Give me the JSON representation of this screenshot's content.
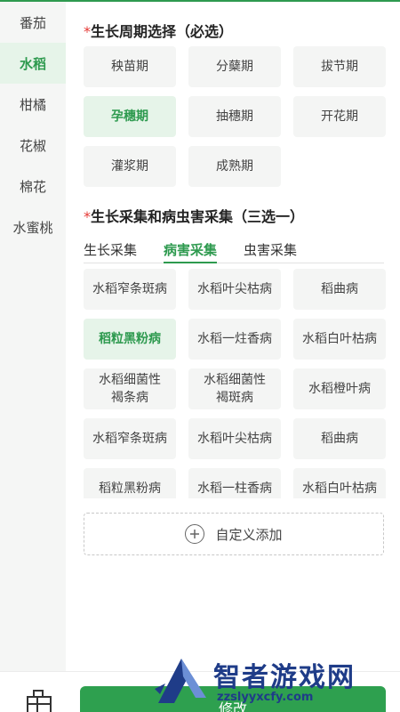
{
  "sidebar": {
    "items": [
      {
        "label": "番茄",
        "active": false
      },
      {
        "label": "水稻",
        "active": true
      },
      {
        "label": "柑橘",
        "active": false
      },
      {
        "label": "花椒",
        "active": false
      },
      {
        "label": "棉花",
        "active": false
      },
      {
        "label": "水蜜桃",
        "active": false
      }
    ]
  },
  "growth_period": {
    "required_mark": "*",
    "title": "生长周期选择（必选）",
    "options": [
      {
        "label": "秧苗期",
        "selected": false
      },
      {
        "label": "分蘖期",
        "selected": false
      },
      {
        "label": "拔节期",
        "selected": false
      },
      {
        "label": "孕穗期",
        "selected": true
      },
      {
        "label": "抽穗期",
        "selected": false
      },
      {
        "label": "开花期",
        "selected": false
      },
      {
        "label": "灌浆期",
        "selected": false
      },
      {
        "label": "成熟期",
        "selected": false
      }
    ]
  },
  "collection": {
    "required_mark": "*",
    "title": "生长采集和病虫害采集（三选一）",
    "tabs": [
      {
        "label": "生长采集",
        "active": false
      },
      {
        "label": "病害采集",
        "active": true
      },
      {
        "label": "虫害采集",
        "active": false
      }
    ],
    "options": [
      {
        "label": "水稻窄条斑病",
        "selected": false
      },
      {
        "label": "水稻叶尖枯病",
        "selected": false
      },
      {
        "label": "稻曲病",
        "selected": false
      },
      {
        "label": "稻粒黑粉病",
        "selected": true
      },
      {
        "label": "水稻一炷香病",
        "selected": false
      },
      {
        "label": "水稻白叶枯病",
        "selected": false
      },
      {
        "label": "水稻细菌性褐条病",
        "selected": false
      },
      {
        "label": "水稻细菌性褐斑病",
        "selected": false
      },
      {
        "label": "水稻橙叶病",
        "selected": false
      },
      {
        "label": "水稻窄条斑病",
        "selected": false
      },
      {
        "label": "水稻叶尖枯病",
        "selected": false
      },
      {
        "label": "稻曲病",
        "selected": false
      },
      {
        "label": "稻粒黑粉病",
        "selected": false
      },
      {
        "label": "水稻一柱香病",
        "selected": false
      },
      {
        "label": "水稻白叶枯病",
        "selected": false
      }
    ],
    "add_label": "自定义添加",
    "add_icon": "plus-circle-icon"
  },
  "bottom": {
    "submit_label": "修改",
    "tool_icon": "toolbox-icon"
  },
  "watermark": {
    "text": "智者游戏网",
    "url": "zzslyyxcfy.com"
  },
  "colors": {
    "accent": "#2e9a4f",
    "accent_bg": "#e6f4e9",
    "required": "#e53935",
    "option_bg": "#f4f5f4",
    "sidebar_bg": "#f5f6f5"
  }
}
